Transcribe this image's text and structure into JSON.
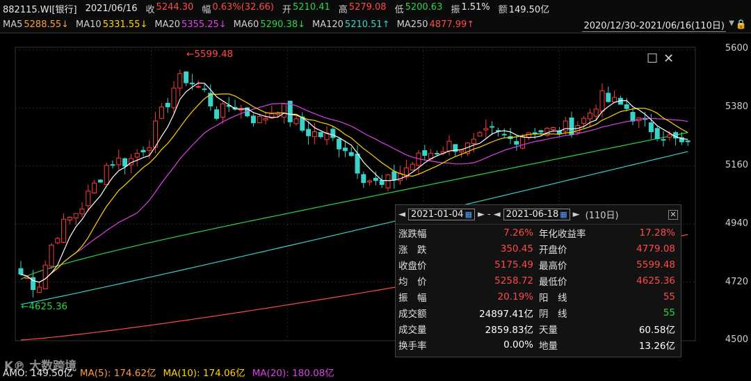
{
  "header": {
    "code": "882115.WI[银行]",
    "date": "2021/06/16",
    "close_label": "收",
    "close": "5244.30",
    "change_label": "幅",
    "change": "0.63%(32.66)",
    "open_label": "开",
    "open": "5210.41",
    "high_label": "高",
    "high": "5279.08",
    "low_label": "低",
    "low": "5200.63",
    "amp_label": "振",
    "amp": "1.51%",
    "amount_label": "额",
    "amount": "149.50亿"
  },
  "ma_bar": {
    "ma5_label": "MA5",
    "ma5": "5288.55↓",
    "ma10_label": "MA10",
    "ma10": "5331.55↓",
    "ma20_label": "MA20",
    "ma20": "5355.25↓",
    "ma60_label": "MA60",
    "ma60": "5290.38↓",
    "ma120_label": "MA120",
    "ma120": "5210.51↑",
    "ma250_label": "MA250",
    "ma250": "4877.99↑",
    "range": "2020/12/30-2021/06/16(110日)"
  },
  "colors": {
    "up": "#ff3b3b",
    "down": "#39d3c9",
    "ma5": "#ffffff",
    "ma10": "#ffd500",
    "ma20": "#e040e8",
    "ma60": "#2bd44a",
    "ma120": "#39d3c9",
    "ma250": "#ff4a4a"
  },
  "chart": {
    "y_ticks": [
      "5600",
      "5380",
      "5160",
      "4940",
      "4720",
      "4500"
    ],
    "max_label": "5599.48",
    "min_label": "4625.36"
  },
  "chart_data": {
    "type": "candlestick",
    "ylim": [
      4500,
      5620
    ],
    "days": 110,
    "max": 5599.48,
    "min": 4625.36
  },
  "panel": {
    "start_date": "2021-01-04",
    "end_date": "2021-06-18",
    "days": "(110日)",
    "rows": [
      {
        "k1": "涨跌幅",
        "v1": "7.26%",
        "k2": "年化收益率",
        "v2": "17.28%"
      },
      {
        "k1": "涨　跌",
        "v1": "350.45",
        "k2": "开盘价",
        "v2": "4779.08"
      },
      {
        "k1": "收盘价",
        "v1": "5175.49",
        "k2": "最高价",
        "v2": "5599.48"
      },
      {
        "k1": "均　价",
        "v1": "5258.72",
        "k2": "最低价",
        "v2": "4625.36"
      },
      {
        "k1": "振　幅",
        "v1": "20.19%",
        "k2": "阳　线",
        "v2": "55"
      },
      {
        "k1": "成交额",
        "v1": "24897.41亿",
        "k2": "阴　线",
        "v2": "55"
      },
      {
        "k1": "成交量",
        "v1": "2859.83亿",
        "k2": "天量",
        "v2": "60.58亿"
      },
      {
        "k1": "换手率",
        "v1": "0.00%",
        "k2": "地量",
        "v2": "13.26亿"
      }
    ]
  },
  "bottom": {
    "amo": "AMO: 149.50亿",
    "ma5": "MA(5): 174.62亿",
    "ma10": "MA(10): 174.06亿",
    "ma20": "MA(20): 180.08亿"
  },
  "watermark": "大数跨境"
}
